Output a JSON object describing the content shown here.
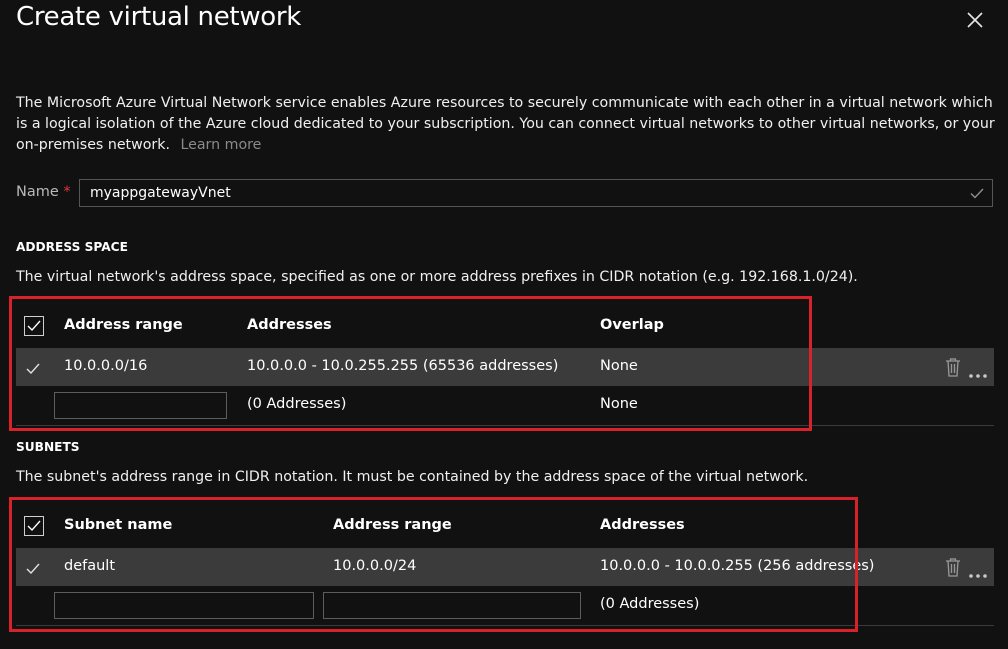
{
  "panel": {
    "title": "Create virtual network",
    "description": "The Microsoft Azure Virtual Network service enables Azure resources to securely communicate with each other in a virtual network which is a logical isolation of the Azure cloud dedicated to your subscription. You can connect virtual networks to other virtual networks, or your on-premises network.",
    "learn_more": "Learn more"
  },
  "name_field": {
    "label": "Name",
    "required_mark": "*",
    "value": "myappgatewayVnet"
  },
  "address_space": {
    "heading": "ADDRESS SPACE",
    "description": "The virtual network's address space, specified as one or more address prefixes in CIDR notation (e.g. 192.168.1.0/24).",
    "columns": [
      "Address range",
      "Addresses",
      "Overlap"
    ],
    "rows": [
      {
        "range": "10.0.0.0/16",
        "addresses": "10.0.0.0 - 10.0.255.255 (65536 addresses)",
        "overlap": "None"
      }
    ],
    "new_row": {
      "addresses": "(0 Addresses)",
      "overlap": "None"
    }
  },
  "subnets": {
    "heading": "SUBNETS",
    "description": "The subnet's address range in CIDR notation. It must be contained by the address space of the virtual network.",
    "columns": [
      "Subnet name",
      "Address range",
      "Addresses"
    ],
    "rows": [
      {
        "name": "default",
        "range": "10.0.0.0/24",
        "addresses": "10.0.0.0 - 10.0.0.255 (256 addresses)"
      }
    ],
    "new_row": {
      "addresses": "(0 Addresses)"
    }
  },
  "colors": {
    "background": "#111111",
    "selected_row": "#3b3b3b",
    "highlight_box": "#d8222a",
    "required": "#e0393e"
  },
  "icons": [
    "close-icon",
    "checkmark-icon",
    "checkbox-icon",
    "delete-icon",
    "more-icon"
  ]
}
